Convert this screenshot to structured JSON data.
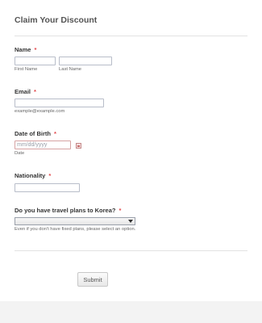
{
  "form": {
    "title": "Claim Your Discount",
    "required_marker": "*",
    "name": {
      "label": "Name",
      "first_sublabel": "First Name",
      "last_sublabel": "Last Name",
      "first_value": "",
      "last_value": ""
    },
    "email": {
      "label": "Email",
      "sublabel": "example@example.com",
      "value": ""
    },
    "dob": {
      "label": "Date of Birth",
      "placeholder": "mm/dd/yyyy",
      "sublabel": "Date",
      "icon": "calendar-icon"
    },
    "nationality": {
      "label": "Nationality",
      "value": ""
    },
    "travel": {
      "label": "Do you have travel plans to Korea?",
      "selected": "",
      "hint": "Even if you don't have fixed plans, please select an option."
    },
    "submit_label": "Submit"
  },
  "colors": {
    "required": "#e2474b",
    "divider": "#e2e2e2",
    "bottom_band": "#f3f3f3"
  }
}
